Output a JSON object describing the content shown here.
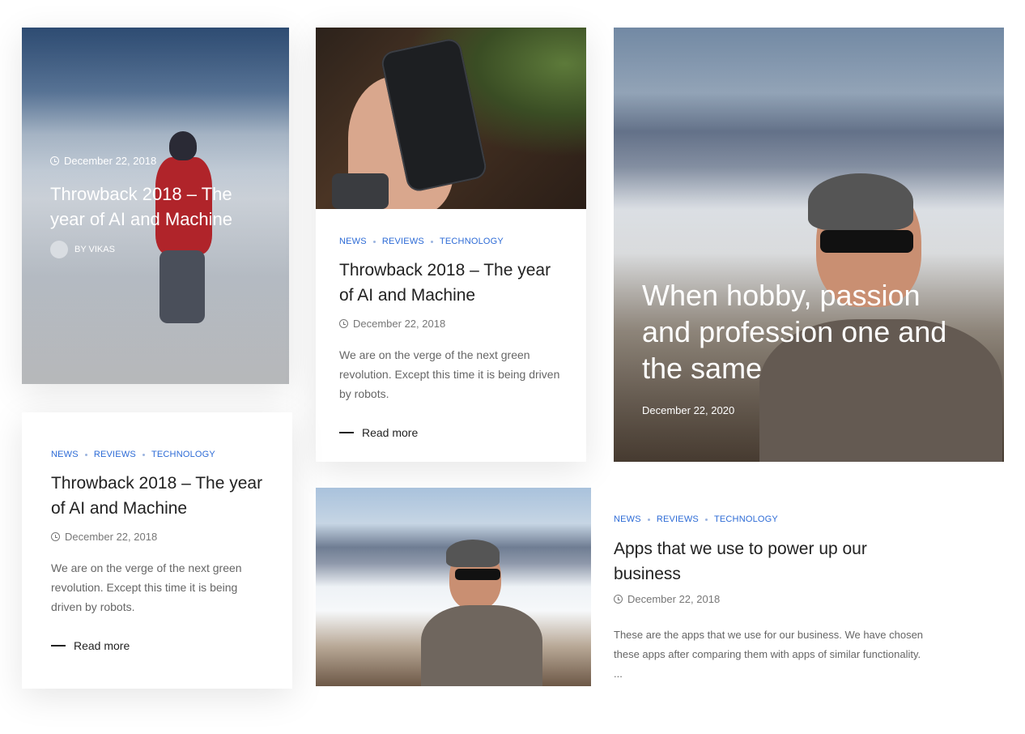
{
  "card_overlay": {
    "date": "December 22, 2018",
    "title": "Throwback 2018 – The year of AI and Machine",
    "author": "BY VIKAS"
  },
  "card_phone": {
    "categories": [
      "NEWS",
      "REVIEWS",
      "TECHNOLOGY"
    ],
    "title": "Throwback 2018 – The year of AI and Machine",
    "date": "December 22, 2018",
    "excerpt": "We are on the verge of the next green revolution. Except this time it is being driven by robots.",
    "read_more": "Read more"
  },
  "card_big": {
    "title": "When hobby, passion and profession one and the same",
    "date": "December 22, 2020"
  },
  "card_text": {
    "categories": [
      "NEWS",
      "REVIEWS",
      "TECHNOLOGY"
    ],
    "title": "Throwback 2018 – The year of AI and Machine",
    "date": "December 22, 2018",
    "excerpt": "We are on the verge of the next green revolution. Except this time it is being driven by robots.",
    "read_more": "Read more"
  },
  "card_apps": {
    "categories": [
      "NEWS",
      "REVIEWS",
      "TECHNOLOGY"
    ],
    "title": "Apps that we use to power up our business",
    "date": "December 22, 2018",
    "excerpt": "These are the apps that we use for our business. We have chosen these apps after comparing them with apps of similar functionality. ..."
  },
  "icons": {
    "date": "clock-icon",
    "author": "avatar",
    "read_more": "dash-line-icon"
  },
  "colors": {
    "accent": "#2d6bd6",
    "text": "#222222",
    "muted": "#666666"
  }
}
